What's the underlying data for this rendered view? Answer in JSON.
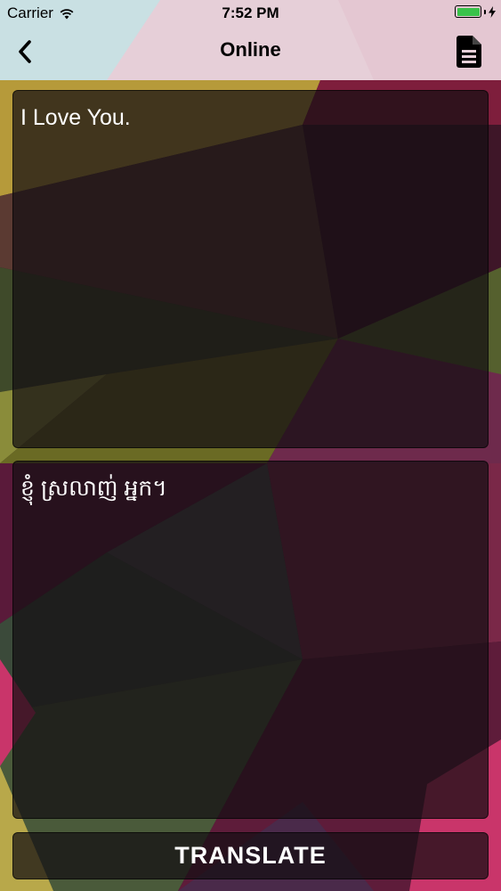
{
  "status_bar": {
    "carrier": "Carrier",
    "time": "7:52 PM",
    "wifi_icon": "wifi-icon",
    "battery_icon": "battery-icon",
    "charging_icon": "bolt-icon",
    "battery_color": "#39c24a"
  },
  "nav": {
    "title": "Online",
    "back_icon": "chevron-left-icon",
    "document_icon": "document-icon"
  },
  "source": {
    "text": "I Love You."
  },
  "result": {
    "text": "ខ្ញុំ ស្រលាញ់ អ្នក។"
  },
  "actions": {
    "translate_label": "TRANSLATE"
  }
}
